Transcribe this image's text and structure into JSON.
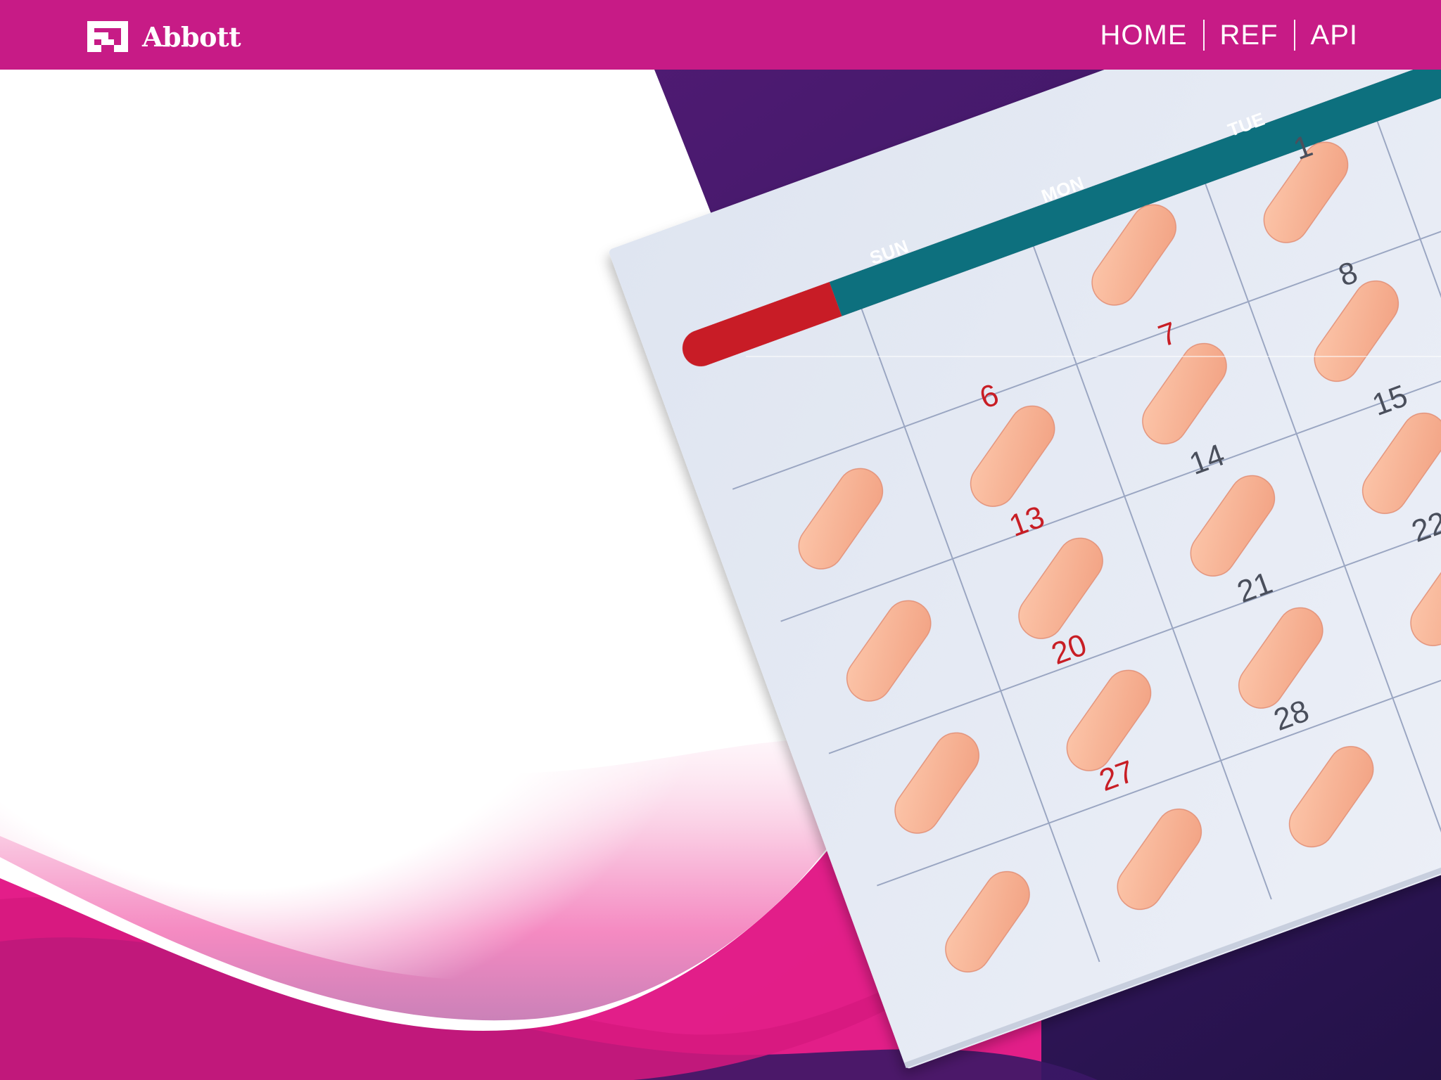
{
  "header": {
    "brand": "Abbott",
    "nav": [
      {
        "label": "HOME"
      },
      {
        "label": "REF"
      },
      {
        "label": "API"
      }
    ]
  },
  "hero": {
    "calendar": {
      "weekdays": [
        "SUN",
        "MON",
        "TUE"
      ],
      "sunday_numbers": [
        "6",
        "13",
        "20",
        "27"
      ],
      "monday_numbers": [
        "7",
        "14",
        "21",
        "28"
      ],
      "tuesday_numbers": [
        "1",
        "8",
        "15",
        "22"
      ]
    }
  },
  "colors": {
    "brand_magenta": "#c71b86",
    "wave_pink": "#e91e8c",
    "deep_purple": "#2f1759",
    "pill": "#f9b596",
    "sunday_red": "#c81e25",
    "header_teal": "#0d6f7e"
  }
}
